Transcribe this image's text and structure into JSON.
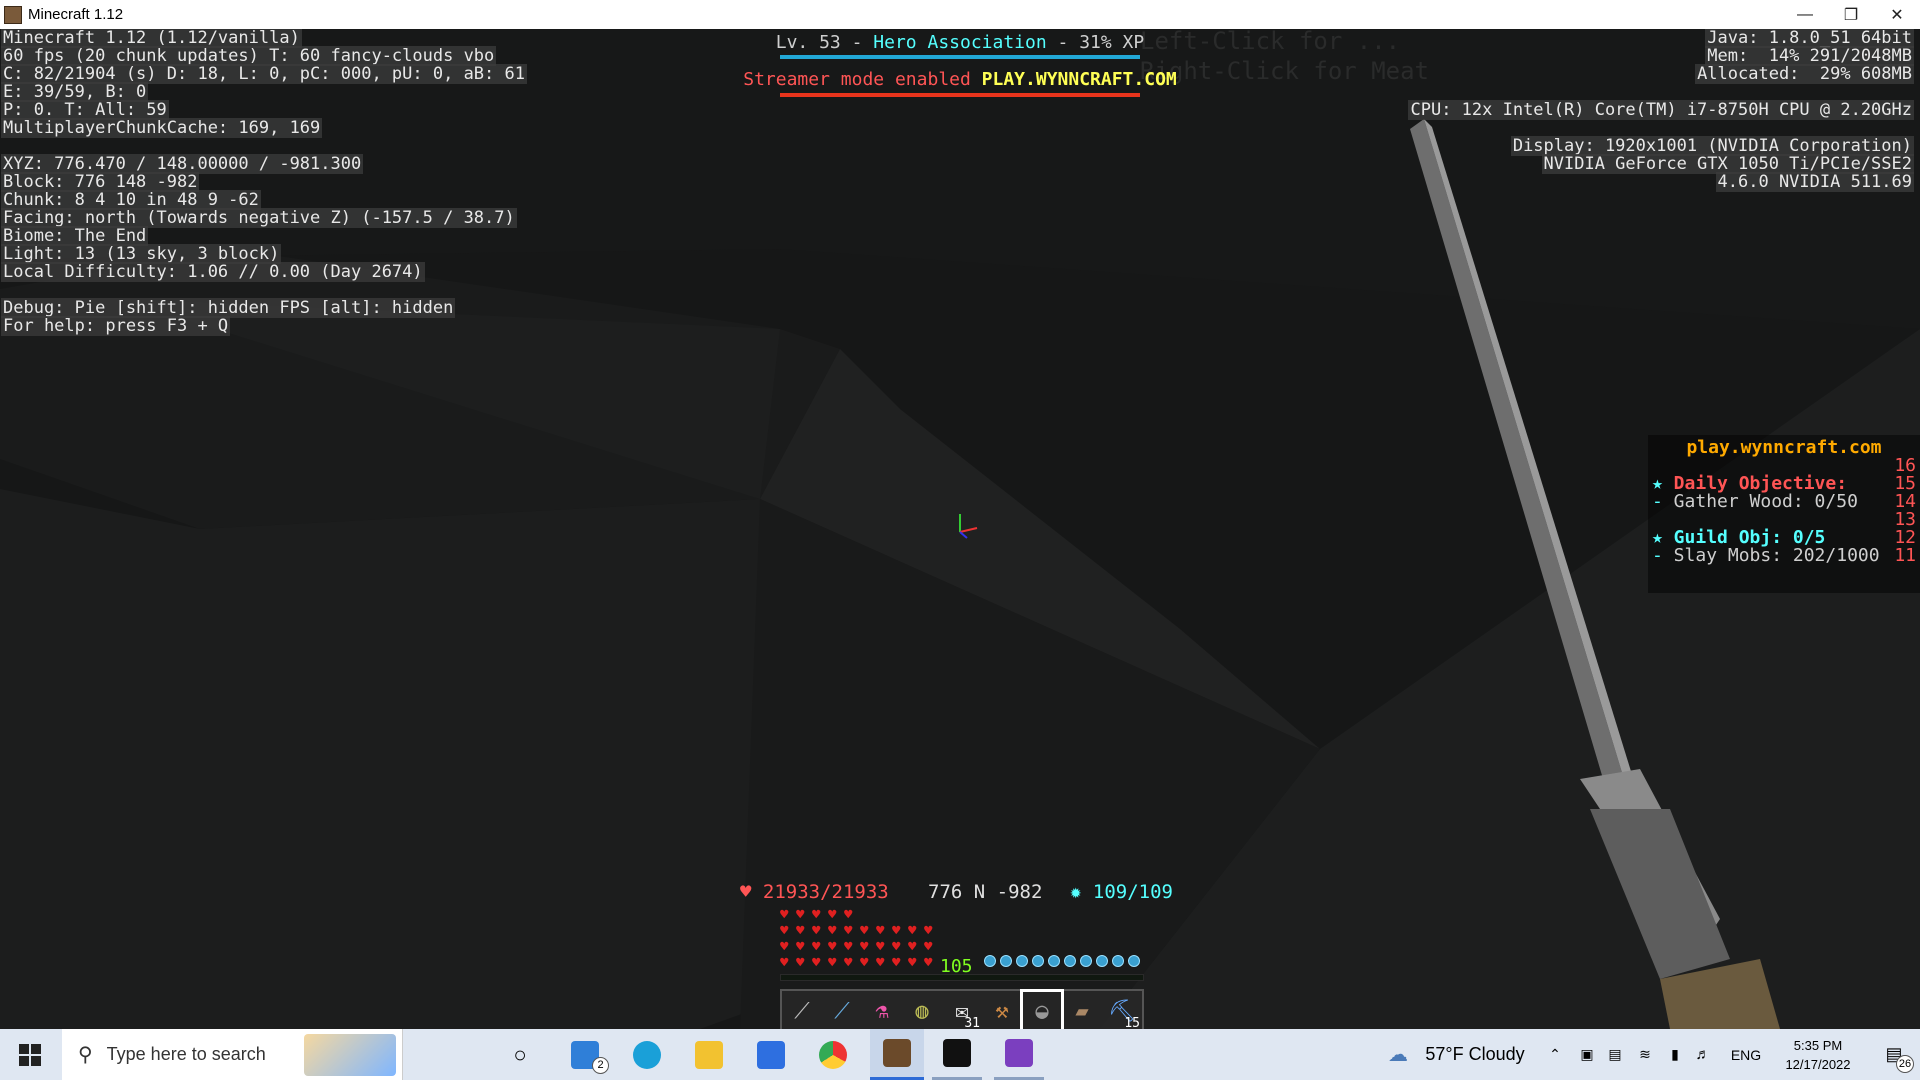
{
  "window": {
    "title": "Minecraft 1.12",
    "minimize_icon": "minimize-icon",
    "maximize_icon": "restore-icon",
    "close_icon": "close-icon"
  },
  "debug_left": [
    "Minecraft 1.12 (1.12/vanilla)",
    "60 fps (20 chunk updates) T: 60 fancy-clouds vbo",
    "C: 82/21904 (s) D: 18, L: 0, pC: 000, pU: 0, aB: 61",
    "E: 39/59, B: 0",
    "P: 0. T: All: 59",
    "MultiplayerChunkCache: 169, 169",
    "",
    "XYZ: 776.470 / 148.00000 / -981.300",
    "Block: 776 148 -982",
    "Chunk: 8 4 10 in 48 9 -62",
    "Facing: north (Towards negative Z) (-157.5 / 38.7)",
    "Biome: The End",
    "Light: 13 (13 sky, 3 block)",
    "Local Difficulty: 1.06 // 0.00 (Day 2674)",
    "",
    "Debug: Pie [shift]: hidden FPS [alt]: hidden",
    "For help: press F3 + Q"
  ],
  "debug_right": [
    "Java: 1.8.0_51 64bit",
    "Mem:  14% 291/2048MB",
    "Allocated:  29% 608MB",
    "",
    "CPU: 12x Intel(R) Core(TM) i7-8750H CPU @ 2.20GHz",
    "",
    "Display: 1920x1001 (NVIDIA Corporation)",
    "NVIDIA GeForce GTX 1050 Ti/PCIe/SSE2",
    "4.6.0 NVIDIA 511.69"
  ],
  "bossbar": {
    "prefix": "Lv. 53 - ",
    "guild": "Hero Association",
    "suffix": " - 31% XP",
    "streamer_text": "Streamer mode enabled ",
    "server": "PLAY.WYNNCRAFT.COM",
    "faded_text_1": "Left-Click for ...",
    "faded_text_2": "Right-Click for Meat",
    "colors": {
      "xp_bar": "#22a8d6",
      "red_bar": "#e8341c",
      "guild": "#55ffff",
      "streamer": "#ff5555",
      "server": "#ffff55"
    }
  },
  "scoreboard": {
    "title": "play.wynncraft.com",
    "rows": [
      {
        "star": "",
        "text": "",
        "num": "16"
      },
      {
        "star": "★",
        "text": "Daily Objective:",
        "num": "15"
      },
      {
        "star": "-",
        "text": "Gather Wood: 0/50",
        "num": "14"
      },
      {
        "star": "",
        "text": "",
        "num": "13"
      },
      {
        "star": "★",
        "text": "Guild Obj: 0/5",
        "num": "12"
      },
      {
        "star": "-",
        "text": "Slay Mobs: 202/1000",
        "num": "11"
      }
    ]
  },
  "hud": {
    "health": "21933/21933",
    "coords": "776 N -982",
    "mana": "109/109",
    "level": "105",
    "health_icon": "heart-icon",
    "mana_icon": "mana-star-icon",
    "hotbar": [
      {
        "icon": "bow-weapon-icon",
        "count": ""
      },
      {
        "icon": "fishing-rod-icon",
        "count": ""
      },
      {
        "icon": "potion-icon",
        "count": ""
      },
      {
        "icon": "emerald-pouch-icon",
        "count": ""
      },
      {
        "icon": "scroll-icon",
        "count": "31"
      },
      {
        "icon": "axe-icon",
        "count": ""
      },
      {
        "icon": "cauldron-icon",
        "count": ""
      },
      {
        "icon": "book-icon",
        "count": ""
      },
      {
        "icon": "pickaxe-icon",
        "count": "15"
      }
    ],
    "selected_slot": 6
  },
  "taskbar": {
    "search_placeholder": "Type here to search",
    "weather": "57°F  Cloudy",
    "lang": "ENG",
    "time": "5:35 PM",
    "date": "12/17/2022",
    "notifications": "26",
    "mail_badge": "2"
  }
}
